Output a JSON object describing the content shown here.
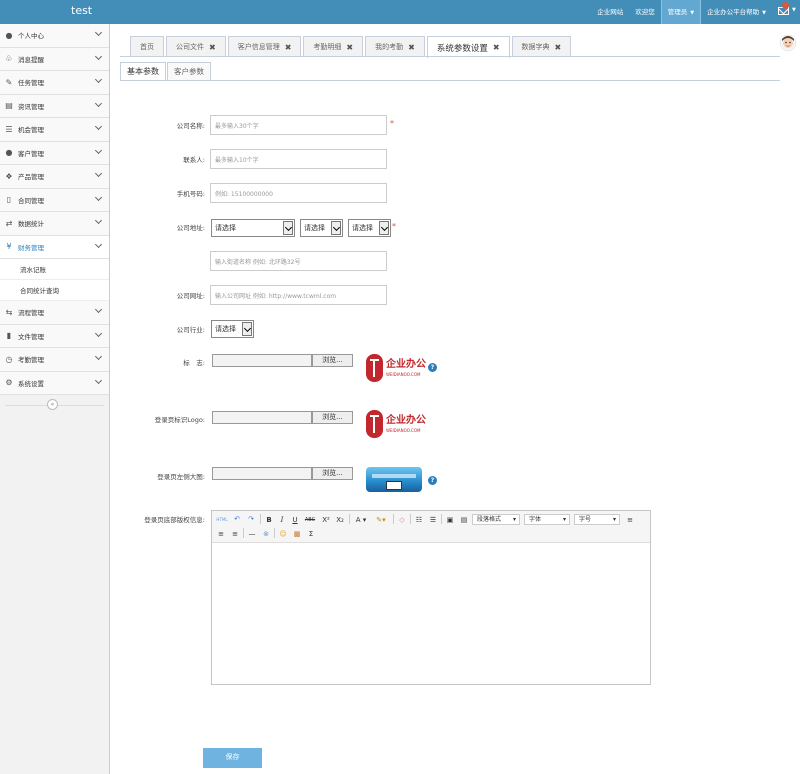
{
  "header": {
    "brand": "test",
    "nav": [
      "企业网站",
      "欢迎您"
    ],
    "user": "管理员",
    "platform": "企业办公平台帮助"
  },
  "sidebar": {
    "items": [
      {
        "label": "个人中心",
        "icon": "user-icon"
      },
      {
        "label": "消息提醒",
        "icon": "bell-icon"
      },
      {
        "label": "任务管理",
        "icon": "edit-icon"
      },
      {
        "label": "资讯管理",
        "icon": "document-icon"
      },
      {
        "label": "机会管理",
        "icon": "list-icon"
      },
      {
        "label": "客户管理",
        "icon": "users-icon"
      },
      {
        "label": "产品管理",
        "icon": "dropbox-icon"
      },
      {
        "label": "合同管理",
        "icon": "folder-open-icon"
      },
      {
        "label": "数据统计",
        "icon": "random-icon"
      },
      {
        "label": "财务管理",
        "icon": "yen-icon"
      }
    ],
    "finance_sub": [
      "流水记账",
      "合同统计查询"
    ],
    "items_after": [
      {
        "label": "流程管理",
        "icon": "retweet-icon"
      },
      {
        "label": "文件管理",
        "icon": "file-icon"
      },
      {
        "label": "考勤管理",
        "icon": "clock-icon"
      },
      {
        "label": "系统设置",
        "icon": "cog-icon"
      }
    ]
  },
  "tabs": [
    "首页",
    "公司文件",
    "客户信息管理",
    "考勤明细",
    "我的考勤",
    "系统参数设置",
    "数据字典"
  ],
  "subtabs": [
    "基本参数",
    "客户参数"
  ],
  "form": {
    "company_name_label": "公司名称:",
    "company_name_placeholder": "最多输入30个字",
    "contact_label": "联系人:",
    "contact_placeholder": "最多输入10个字",
    "phone_label": "手机号码:",
    "phone_placeholder": "例如: 15100000000",
    "address_label": "公司地址:",
    "select_placeholder": "请选择",
    "street_placeholder": "输入街道名称 例如: 北环路32号",
    "website_label": "公司网址:",
    "website_placeholder": "输入公司网址 例如: http://www.tcwml.com",
    "industry_label": "公司行业:",
    "logo_label": "标　志:",
    "login_logo_label": "登录页标识Logo:",
    "login_banner_label": "登录页左侧大图:",
    "copyright_label": "登录页底部版权信息:",
    "browse": "浏览...",
    "required_mark": "*",
    "help": "?"
  },
  "logo_image": {
    "text_cn": "企业办公",
    "text_en": "WEIDIANOO.COM"
  },
  "editor_toolbar": {
    "paragraph_format": "段落格式",
    "font": "字体",
    "size": "字号",
    "buttons": [
      "B",
      "I",
      "U",
      "ABC",
      "X²",
      "X₂",
      "A",
      "Σ"
    ],
    "html": "HTML"
  },
  "save_label": "保存"
}
